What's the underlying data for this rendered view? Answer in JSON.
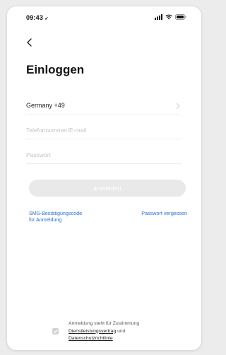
{
  "status_bar": {
    "time": "09:43",
    "location_glyph": "➹"
  },
  "icons": {
    "back": "chevron-left-icon",
    "country_chevron": "chevron-right-icon",
    "signal": "signal-icon",
    "wifi": "wifi-icon",
    "battery": "battery-icon",
    "checkbox": "check-icon"
  },
  "page": {
    "title": "Einloggen"
  },
  "form": {
    "country_label": "Germany +49",
    "phone_email_placeholder": "Telefonnummer/E-mail",
    "phone_email_value": "",
    "password_placeholder": "Passwort",
    "password_value": "",
    "login_button_label": "anmelden"
  },
  "links": {
    "sms_login": "SMS-Bestätigungscode\nfür Anmeldung",
    "forgot_password": "Passwort vergessen"
  },
  "consent": {
    "line1": "Anmeldung steht für Zustimmung",
    "terms_link": "Dienstleistungsvertrag",
    "and_word": " und",
    "privacy_link": "Datenschutzrichtlinie",
    "checked": true
  },
  "colors": {
    "link": "#2a6fd6",
    "button_disabled_bg": "#e9e9e9",
    "placeholder": "#c4c4c4"
  }
}
